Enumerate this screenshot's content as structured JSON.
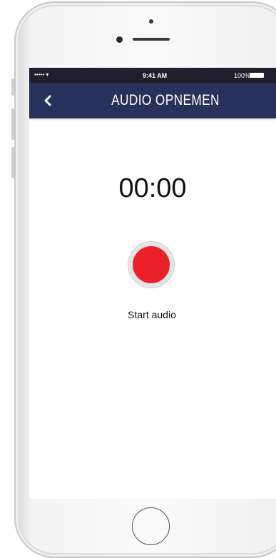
{
  "status_bar": {
    "signal": "••••• ▾",
    "time": "9:41 AM",
    "battery": "100%"
  },
  "nav": {
    "back_icon": "‹",
    "title": "AUDIO OPNEMEN"
  },
  "timer": {
    "value": "00:00"
  },
  "record": {
    "label": "Start audio"
  },
  "colors": {
    "nav_background": "#27315a",
    "record_button": "#ec2029"
  }
}
